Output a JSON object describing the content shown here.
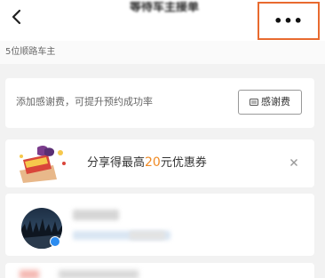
{
  "header": {
    "title": "等待车主接单",
    "subtitle": "",
    "back_icon": "chevron-left-icon",
    "more_label": "•••"
  },
  "drivers_strip": {
    "count_text": "5位顺路车主"
  },
  "thank_fee": {
    "text": "添加感谢费，可提升预约成功率",
    "button_label": "感谢费",
    "button_icon": "wallet-icon"
  },
  "share_banner": {
    "text_before": "分享得最高",
    "amount": "20",
    "text_after": "元优惠券",
    "gift_icon": "gift-box-icon",
    "close_icon": "close-icon",
    "colors": {
      "accent": "#f08a24"
    }
  },
  "colors": {
    "highlight_border": "#e86a2f",
    "background": "#f2f2f2"
  }
}
